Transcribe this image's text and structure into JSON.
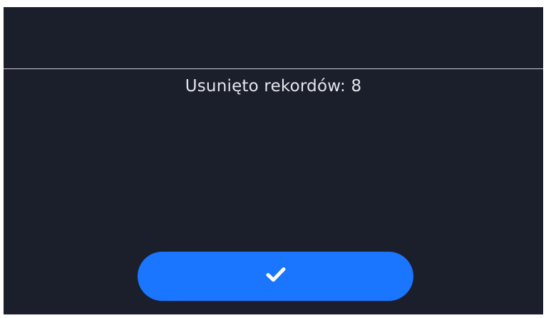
{
  "dialog": {
    "message": "Usunięto rekordów: 8",
    "confirm_icon": "checkmark-icon"
  },
  "colors": {
    "background": "#1b1f2b",
    "accent": "#1a75ff",
    "text": "#e3e6ee",
    "divider": "#c9ccd3"
  }
}
